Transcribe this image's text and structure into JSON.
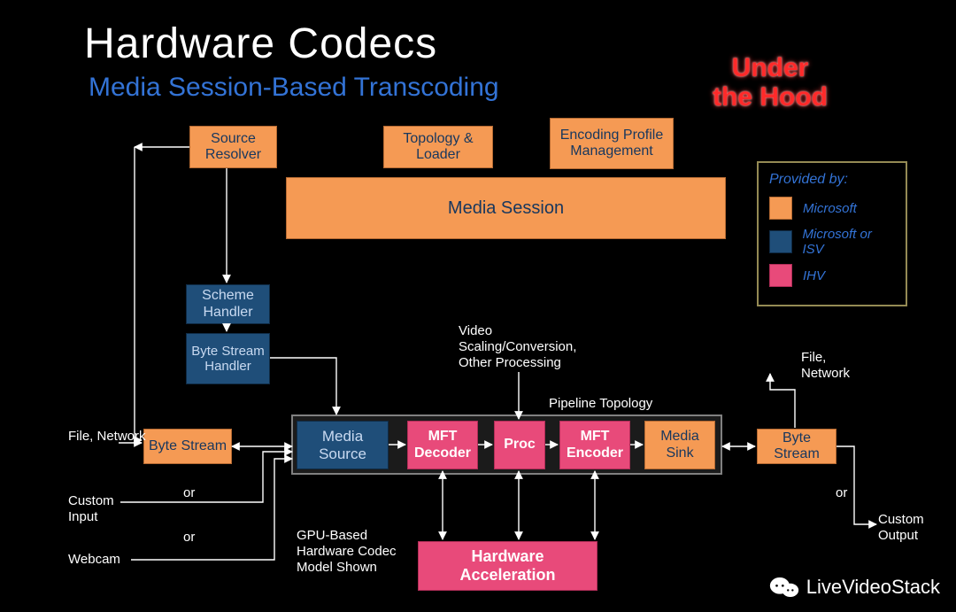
{
  "title": "Hardware Codecs",
  "subtitle": "Media Session-Based Transcoding",
  "corner_l1": "Under",
  "corner_l2": "the Hood",
  "boxes": {
    "source_resolver": "Source Resolver",
    "topology_loader": "Topology & Loader",
    "encoding_profile": "Encoding Profile Management",
    "media_session": "Media Session",
    "scheme_handler": "Scheme Handler",
    "byte_stream_handler": "Byte Stream Handler",
    "byte_stream_left": "Byte Stream",
    "media_source": "Media Source",
    "mft_decoder": "MFT Decoder",
    "proc": "Proc",
    "mft_encoder": "MFT Encoder",
    "media_sink": "Media Sink",
    "byte_stream_right": "Byte Stream",
    "hw_accel": "Hardware Acceleration"
  },
  "labels": {
    "file_network_left": "File, Network",
    "custom_input": "Custom Input",
    "webcam": "Webcam",
    "or1": "or",
    "or2": "or",
    "or3": "or",
    "video_scaling": "Video Scaling/Conversion, Other Processing",
    "pipeline": "Pipeline Topology",
    "gpu_note": "GPU-Based Hardware Codec Model Shown",
    "file_network_right": "File, Network",
    "custom_output": "Custom Output"
  },
  "legend": {
    "title": "Provided by:",
    "items": [
      {
        "color": "#f59a54",
        "text": "Microsoft"
      },
      {
        "color": "#1f4e79",
        "text": "Microsoft or ISV"
      },
      {
        "color": "#e84a7a",
        "text": "IHV"
      }
    ]
  },
  "watermark": "LiveVideoStack"
}
